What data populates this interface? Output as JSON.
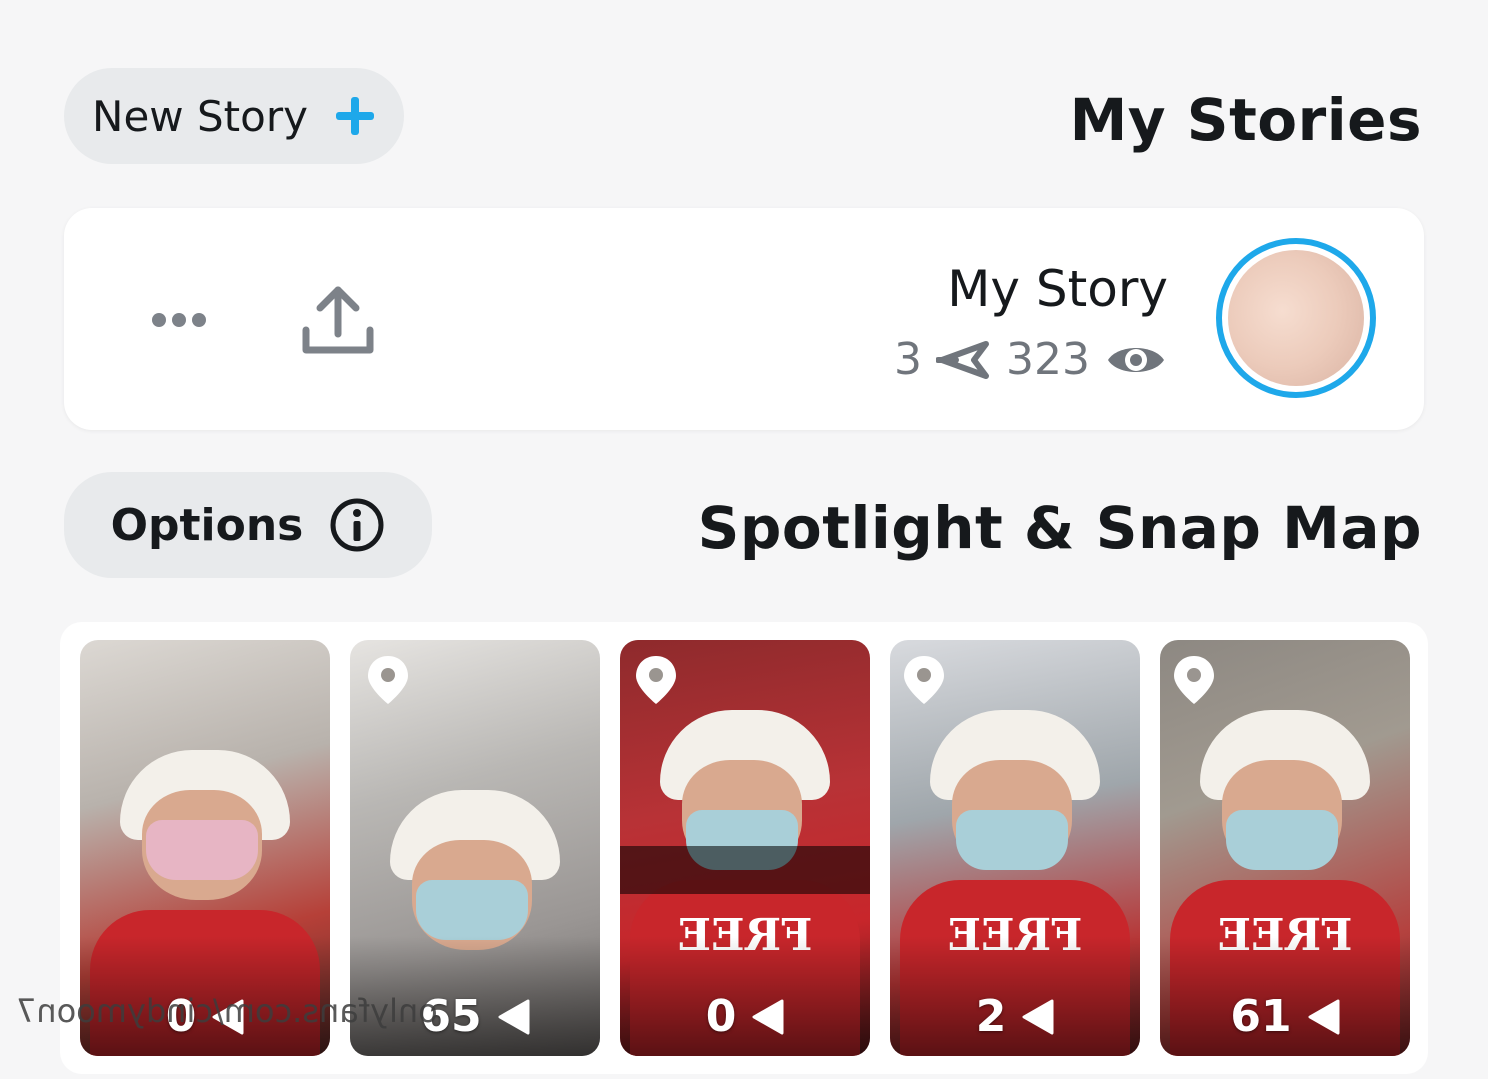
{
  "my_stories": {
    "title": "My Stories",
    "new_story_label": "New Story"
  },
  "story_card": {
    "name": "My Story",
    "views": "323",
    "screenshots": "3",
    "icons": [
      "eye-icon",
      "screenshot-icon",
      "upload-icon",
      "more-icon"
    ]
  },
  "spotlight": {
    "title": "Spotlight & Snap Map",
    "options_label": "Options"
  },
  "tiles": [
    {
      "count": "61"
    },
    {
      "count": "2"
    },
    {
      "count": "0"
    },
    {
      "count": "65"
    },
    {
      "count": "0"
    }
  ],
  "watermark": "onlyfans.com/cindymoon7",
  "colors": {
    "accent": "#1ea8ea",
    "background": "#f6f6f7",
    "shirt": "#c8262b"
  }
}
